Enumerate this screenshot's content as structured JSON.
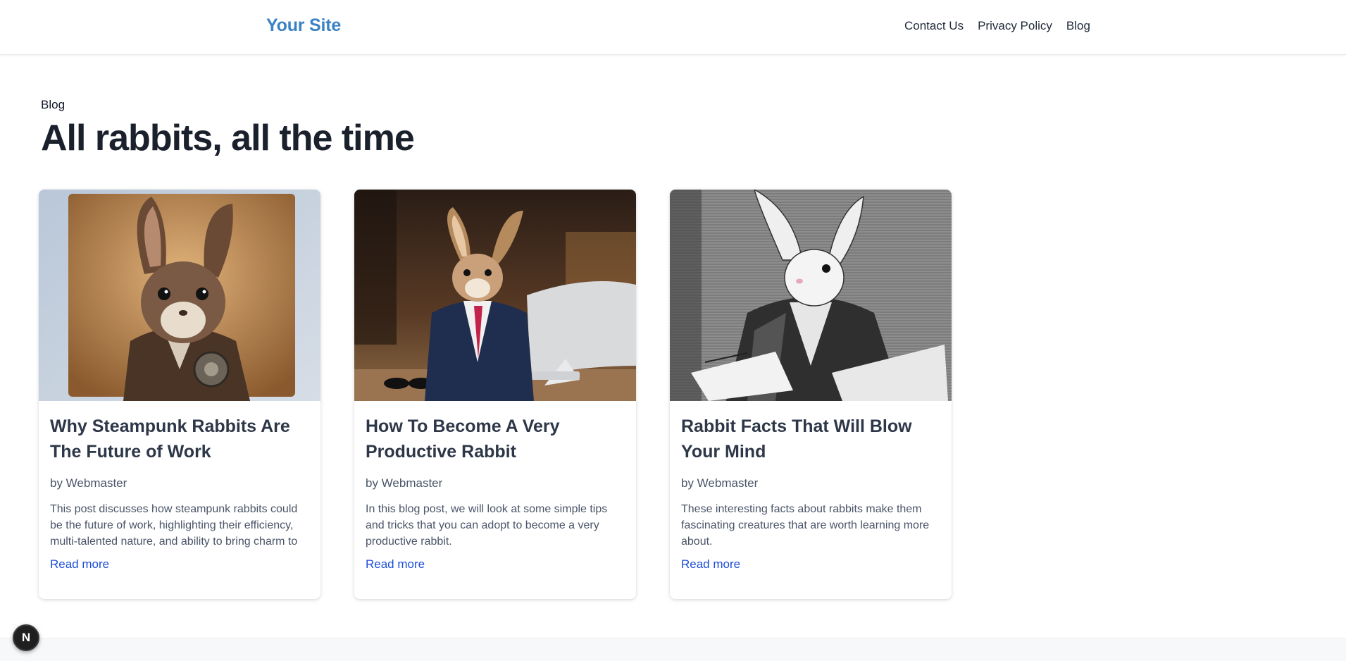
{
  "header": {
    "logo": "Your Site",
    "nav": [
      "Contact Us",
      "Privacy Policy",
      "Blog"
    ]
  },
  "breadcrumb": "Blog",
  "page_title": "All rabbits, all the time",
  "posts": [
    {
      "title": "Why Steampunk Rabbits Are The Future of Work",
      "author": "by Webmaster",
      "excerpt": "This post discusses how steampunk rabbits could be the future of work, highlighting their efficiency, multi-talented nature, and ability to bring charm to",
      "link": "Read more",
      "image_alt": "steampunk-rabbit-portrait"
    },
    {
      "title": "How To Become A Very Productive Rabbit",
      "author": "by Webmaster",
      "excerpt": "In this blog post, we will look at some simple tips and tricks that you can adopt to become a very productive rabbit.",
      "link": "Read more",
      "image_alt": "rabbit-in-suit-at-office"
    },
    {
      "title": "Rabbit Facts That Will Blow Your Mind",
      "author": "by Webmaster",
      "excerpt": "These interesting facts about rabbits make them fascinating creatures that are worth learning more about.",
      "link": "Read more",
      "image_alt": "engraved-rabbit-writing"
    }
  ],
  "badge": "N",
  "colors": {
    "logo": "#3b82c4",
    "link": "#1d4ed8",
    "title": "#1a202c"
  }
}
